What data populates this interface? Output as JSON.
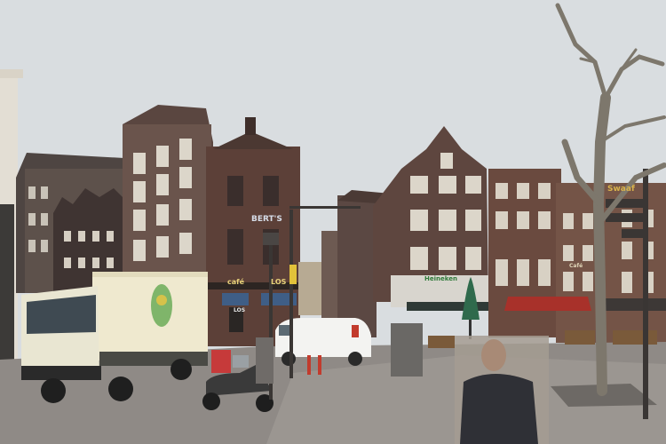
{
  "scene": {
    "signs": {
      "cafe_left": "café",
      "cafe_right": "LOS",
      "round_building": "BERT'S",
      "heineken": "Heineken",
      "red_sign": "",
      "gold_sign": "Swaaf",
      "cafe_far_right": "Café",
      "door_label": "LOS",
      "truck_label": ""
    },
    "colors": {
      "sky": "#d9dde0",
      "brick": "#6e4a3c",
      "dark_brick": "#4d3630",
      "street": "#8f8a86",
      "truck_cab": "#e9e6d2",
      "truck_box": "#efe9cf",
      "van": "#f3f3f1",
      "tree": "#7d776c",
      "awning_red": "#a8312a",
      "awning_blue": "#3f5e86",
      "umbrella_green": "#2f6a4c"
    }
  }
}
